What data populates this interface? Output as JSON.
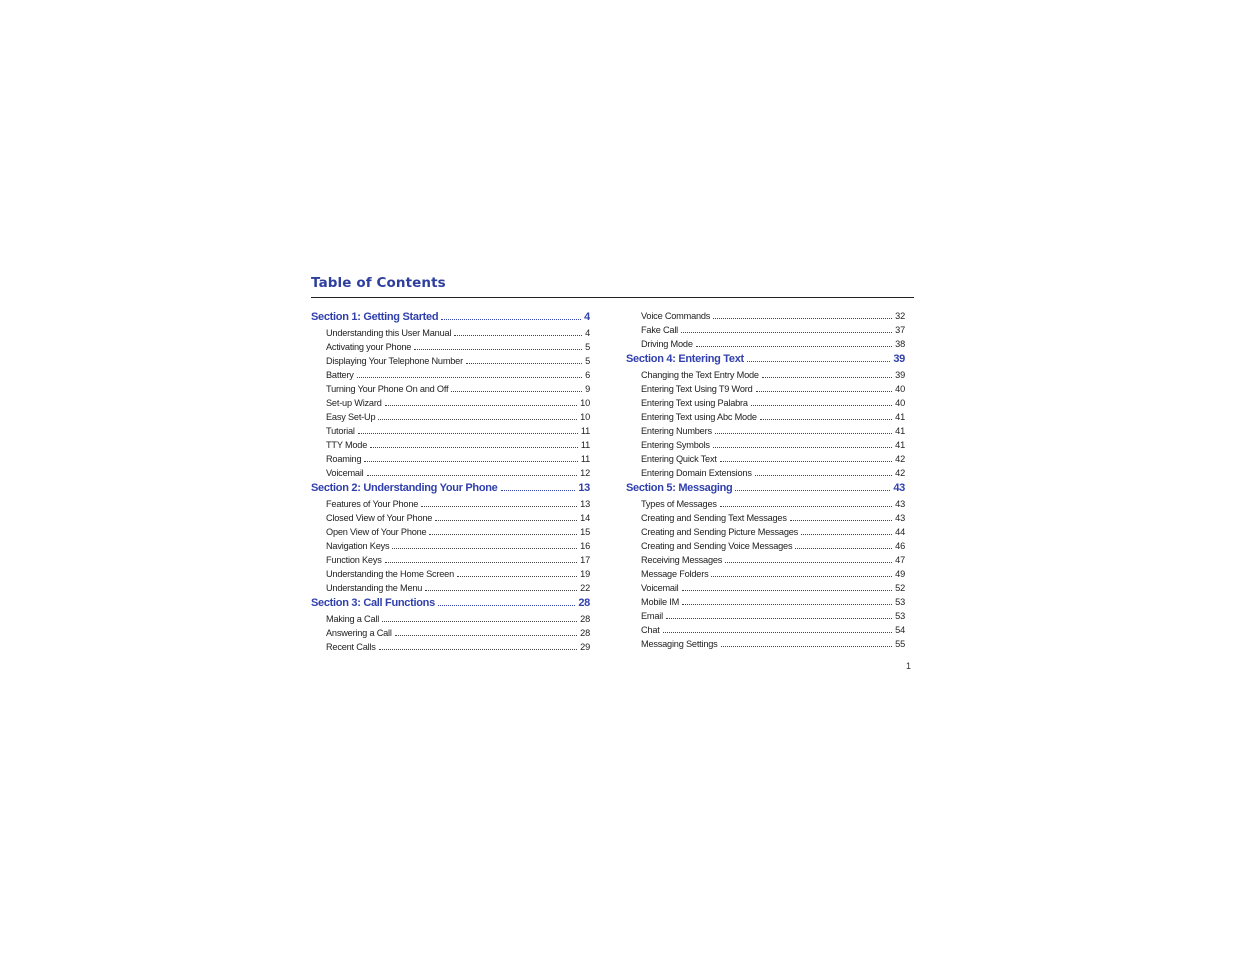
{
  "page_title": "Table of Contents",
  "page_number": "1",
  "left_column": [
    {
      "type": "section",
      "label": "Section 1:  Getting Started",
      "page": "4"
    },
    {
      "type": "item",
      "label": "Understanding this User Manual",
      "page": "4"
    },
    {
      "type": "item",
      "label": "Activating your Phone",
      "page": "5"
    },
    {
      "type": "item",
      "label": "Displaying Your Telephone Number",
      "page": "5"
    },
    {
      "type": "item",
      "label": "Battery",
      "page": "6"
    },
    {
      "type": "item",
      "label": "Turning Your Phone On and Off",
      "page": "9"
    },
    {
      "type": "item",
      "label": "Set-up Wizard",
      "page": "10"
    },
    {
      "type": "item",
      "label": "Easy Set-Up",
      "page": "10"
    },
    {
      "type": "item",
      "label": "Tutorial",
      "page": "11"
    },
    {
      "type": "item",
      "label": "TTY Mode",
      "page": "11"
    },
    {
      "type": "item",
      "label": "Roaming",
      "page": "11"
    },
    {
      "type": "item",
      "label": "Voicemail",
      "page": "12"
    },
    {
      "type": "section",
      "label": "Section 2:  Understanding Your Phone",
      "page": "13"
    },
    {
      "type": "item",
      "label": "Features of Your Phone",
      "page": "13"
    },
    {
      "type": "item",
      "label": "Closed View of Your Phone",
      "page": "14"
    },
    {
      "type": "item",
      "label": "Open View of Your Phone",
      "page": "15"
    },
    {
      "type": "item",
      "label": "Navigation Keys",
      "page": "16"
    },
    {
      "type": "item",
      "label": "Function Keys",
      "page": "17"
    },
    {
      "type": "item",
      "label": "Understanding the Home Screen",
      "page": "19"
    },
    {
      "type": "item",
      "label": "Understanding the Menu",
      "page": "22"
    },
    {
      "type": "section",
      "label": "Section 3:  Call Functions",
      "page": "28"
    },
    {
      "type": "item",
      "label": "Making a Call",
      "page": "28"
    },
    {
      "type": "item",
      "label": "Answering a Call",
      "page": "28"
    },
    {
      "type": "item",
      "label": "Recent Calls",
      "page": "29"
    }
  ],
  "right_column": [
    {
      "type": "item",
      "label": "Voice Commands",
      "page": "32"
    },
    {
      "type": "item",
      "label": "Fake Call",
      "page": "37"
    },
    {
      "type": "item",
      "label": "Driving Mode",
      "page": "38"
    },
    {
      "type": "section",
      "label": "Section 4:  Entering Text",
      "page": "39"
    },
    {
      "type": "item",
      "label": "Changing the Text Entry Mode",
      "page": "39"
    },
    {
      "type": "item",
      "label": "Entering Text Using T9 Word",
      "page": "40"
    },
    {
      "type": "item",
      "label": "Entering Text using Palabra",
      "page": "40"
    },
    {
      "type": "item",
      "label": "Entering Text using Abc Mode",
      "page": "41"
    },
    {
      "type": "item",
      "label": "Entering Numbers",
      "page": "41"
    },
    {
      "type": "item",
      "label": "Entering Symbols",
      "page": "41"
    },
    {
      "type": "item",
      "label": "Entering Quick Text",
      "page": "42"
    },
    {
      "type": "item",
      "label": "Entering Domain Extensions",
      "page": "42"
    },
    {
      "type": "section",
      "label": "Section 5:  Messaging",
      "page": "43"
    },
    {
      "type": "item",
      "label": "Types of Messages",
      "page": "43"
    },
    {
      "type": "item",
      "label": "Creating and Sending Text Messages",
      "page": "43"
    },
    {
      "type": "item",
      "label": "Creating and Sending Picture Messages",
      "page": "44"
    },
    {
      "type": "item",
      "label": "Creating and Sending Voice Messages",
      "page": "46"
    },
    {
      "type": "item",
      "label": "Receiving Messages",
      "page": "47"
    },
    {
      "type": "item",
      "label": "Message Folders",
      "page": "49"
    },
    {
      "type": "item",
      "label": "Voicemail",
      "page": "52"
    },
    {
      "type": "item",
      "label": "Mobile IM",
      "page": "53"
    },
    {
      "type": "item",
      "label": "Email",
      "page": "53"
    },
    {
      "type": "item",
      "label": "Chat",
      "page": "54"
    },
    {
      "type": "item",
      "label": "Messaging Settings",
      "page": "55"
    }
  ]
}
